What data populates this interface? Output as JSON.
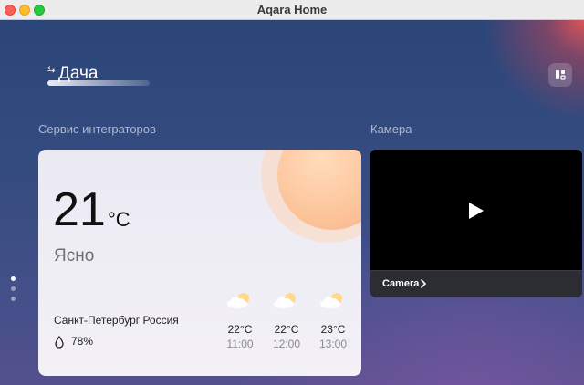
{
  "window": {
    "title": "Aqara Home"
  },
  "home": {
    "name": "Дача"
  },
  "sections": {
    "weather_label": "Сервис интеграторов",
    "camera_label": "Камера"
  },
  "weather": {
    "temperature": "21",
    "unit": "°C",
    "condition": "Ясно",
    "location": "Санкт-Петербург Россия",
    "humidity": "78%",
    "forecast": [
      {
        "temp": "22°C",
        "time": "11:00",
        "icon": "partly-cloudy-icon"
      },
      {
        "temp": "22°C",
        "time": "12:00",
        "icon": "partly-cloudy-icon"
      },
      {
        "temp": "23°C",
        "time": "13:00",
        "icon": "partly-cloudy-icon"
      }
    ]
  },
  "camera": {
    "name": "Camera"
  },
  "pager": {
    "count": 3,
    "active_index": 0
  },
  "colors": {
    "background_top": "#2c4579",
    "background_bottom": "#55508e",
    "weather_card": "#ebeaf3",
    "sun": "#fcc49a",
    "camera_bg": "#000000",
    "camera_bar": "#2b2d33"
  }
}
